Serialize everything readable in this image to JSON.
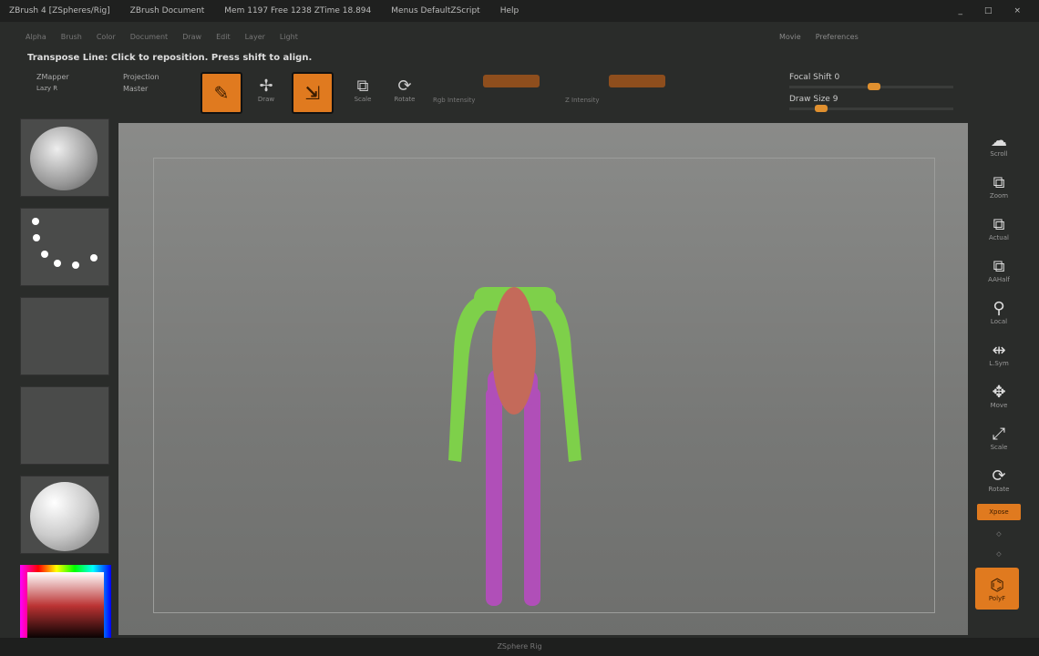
{
  "titlebar": {
    "app": "ZBrush 4 [ZSpheres/Rig]",
    "document": "ZBrush Document",
    "memory": "Mem 1197 Free 1238 ZTime 18.894",
    "menus_label": "Menus DefaultZScript",
    "help": "Help"
  },
  "menu_items": [
    "Alpha",
    "Brush",
    "Color",
    "Document",
    "Draw",
    "Edit",
    "Layer",
    "Light"
  ],
  "menu_right": [
    "Movie",
    "Preferences"
  ],
  "message": "Transpose Line: Click to reposition. Press shift to align.",
  "toolbar": {
    "zmapper": "ZMapper",
    "lazy": "Lazy R",
    "projection": "Projection",
    "master": "Master",
    "edit": "Edit",
    "draw": "Draw",
    "move": "Move",
    "scale": "Scale",
    "rotate": "Rotate",
    "focal_shift": "Focal Shift 0",
    "draw_size": "Draw Size 9",
    "rgb_intensity": "Rgb Intensity",
    "z_intensity": "Z Intensity"
  },
  "focal_shift_value": 0,
  "draw_size_value": 9,
  "right_shelf": [
    "Scroll",
    "Zoom",
    "Actual",
    "AAHalf",
    "Local",
    "L.Sym",
    "Move",
    "Scale",
    "Rotate",
    "Xpose",
    "",
    "",
    "PolyF"
  ],
  "colors": {
    "accent": "#e07a1f",
    "torso": "#c46a5a",
    "arms": "#7ed04a",
    "legs": "#b04fb8"
  },
  "status": "ZSphere Rig"
}
